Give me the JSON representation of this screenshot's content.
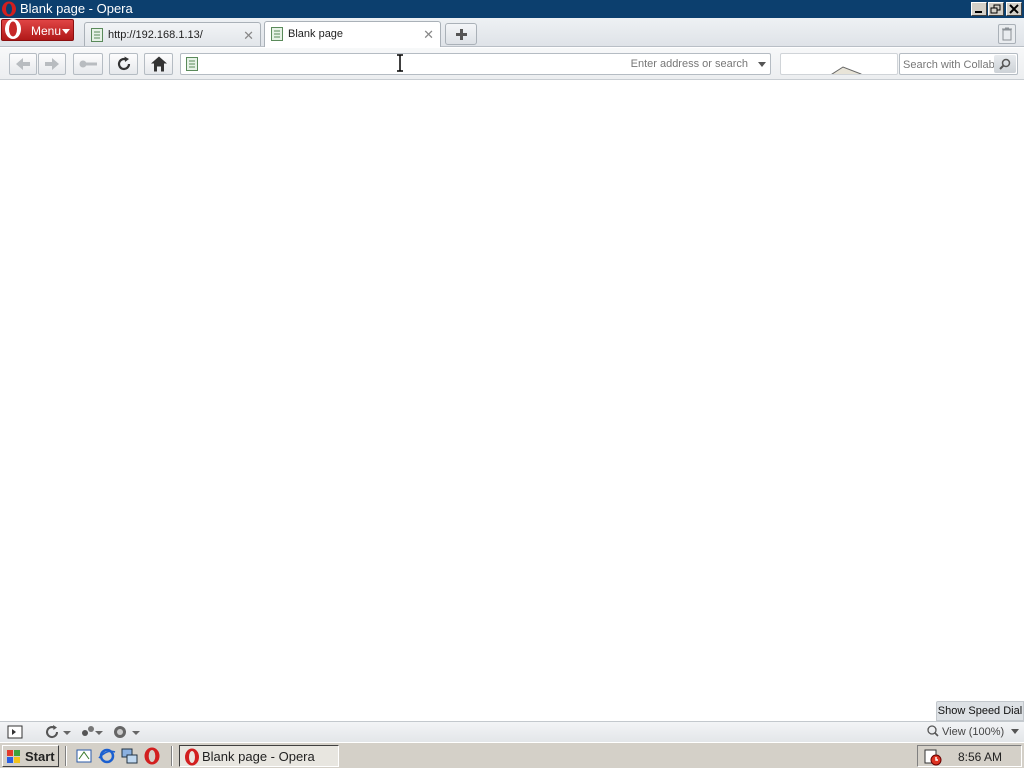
{
  "window": {
    "title": "Blank page - Opera",
    "controls": [
      "minimize",
      "restore",
      "close"
    ]
  },
  "menu": {
    "label": "Menu"
  },
  "tabs": [
    {
      "label": "http://192.168.1.13/",
      "active": false
    },
    {
      "label": "Blank page",
      "active": true
    }
  ],
  "toolbar": {
    "address_value": "",
    "address_placeholder": "Enter address or search",
    "search_placeholder": "Search with Collab'"
  },
  "content": {
    "speed_dial_label": "Show Speed Dial"
  },
  "statusbar": {
    "zoom_label": "View (100%)"
  },
  "taskbar": {
    "start_label": "Start",
    "task_label": "Blank page - Opera",
    "clock": "8:56 AM"
  },
  "colors": {
    "titlebar": "#0c3f6e",
    "menu_button": "#c62828",
    "taskbar": "#d4d0c8"
  }
}
